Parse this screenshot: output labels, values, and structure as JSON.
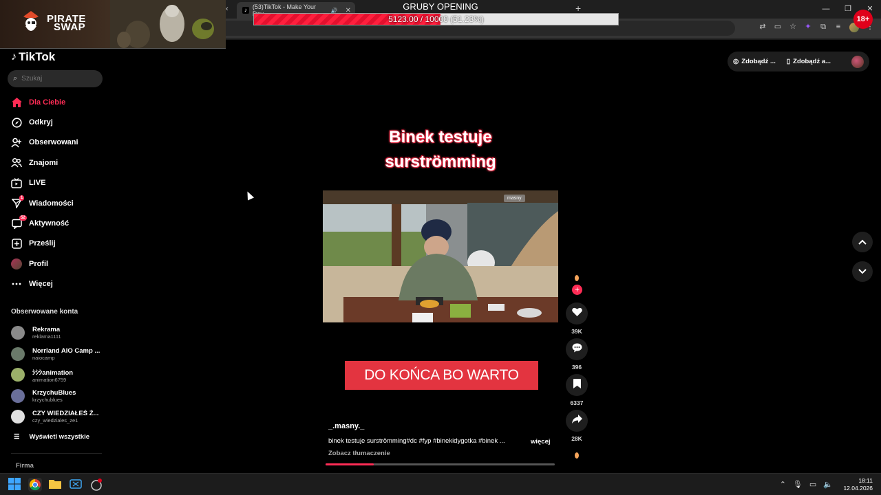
{
  "overlay": {
    "brand_line1": "PIRATE",
    "brand_line2": "SWAP",
    "goal_title": "GRUBY OPENING",
    "goal_text": "5123.00 / 10000 (51.23%)",
    "goal_progress": 0.5123,
    "age_badge": "18+"
  },
  "browser": {
    "tab_title": "(53)TikTok - Make Your Day",
    "new_tab": "+",
    "window_buttons": [
      "—",
      "❐",
      "✕"
    ]
  },
  "sidebar": {
    "logo": "TikTok",
    "search_placeholder": "Szukaj",
    "nav": [
      {
        "label": "Dla Ciebie",
        "icon": "home-icon",
        "active": true
      },
      {
        "label": "Odkryj",
        "icon": "compass-icon"
      },
      {
        "label": "Obserwowani",
        "icon": "user-follow-icon"
      },
      {
        "label": "Znajomi",
        "icon": "friends-icon"
      },
      {
        "label": "LIVE",
        "icon": "live-icon"
      },
      {
        "label": "Wiadomości",
        "icon": "messages-icon",
        "badge": "1"
      },
      {
        "label": "Aktywność",
        "icon": "activity-icon",
        "badge": "52"
      },
      {
        "label": "Prześlij",
        "icon": "upload-icon"
      },
      {
        "label": "Profil",
        "icon": "profile-avatar"
      },
      {
        "label": "Więcej",
        "icon": "more-icon"
      }
    ],
    "following_title": "Obserwowane konta",
    "following": [
      {
        "name": "Rekrama",
        "handle": "reklama1111",
        "color": "#8a8a8a"
      },
      {
        "name": "Norrland AIO Camp ...",
        "handle": "naiocamp",
        "color": "#6a7a6a"
      },
      {
        "name": "ｼｼｼanimation",
        "handle": "animation6759",
        "color": "#9bb06a"
      },
      {
        "name": "KrzychuBlues",
        "handle": "krzychublues",
        "color": "#6a6f9a"
      },
      {
        "name": "CZY WIEDZIAŁEŚ Ż...",
        "handle": "czy_wiedziales_ze1",
        "color": "#e0e0e0"
      }
    ],
    "see_all": "Wyświetl wszystkie",
    "firma": "Firma"
  },
  "top_right": {
    "btn1": "Zdobądź ...",
    "btn2": "Zdobądź a..."
  },
  "video": {
    "title_line1": "Binek testuje",
    "title_line2": "surströmming",
    "watermark": "masny",
    "cta": "DO KOŃCA BO WARTO",
    "author": "_.masny._",
    "description": "binek testuje surströmming#dc #fyp #binekidygotka #binek ...",
    "more": "więcej",
    "translate": "Zobacz tłumaczenie",
    "progress": 0.21
  },
  "actions": {
    "likes": "39K",
    "comments": "396",
    "saves": "6337",
    "shares": "28K"
  },
  "taskbar": {
    "time": "18:11",
    "date": "12.04.2026"
  },
  "colors": {
    "accent": "#fe2c55",
    "cta_bg": "#e33440",
    "background": "#000000"
  }
}
